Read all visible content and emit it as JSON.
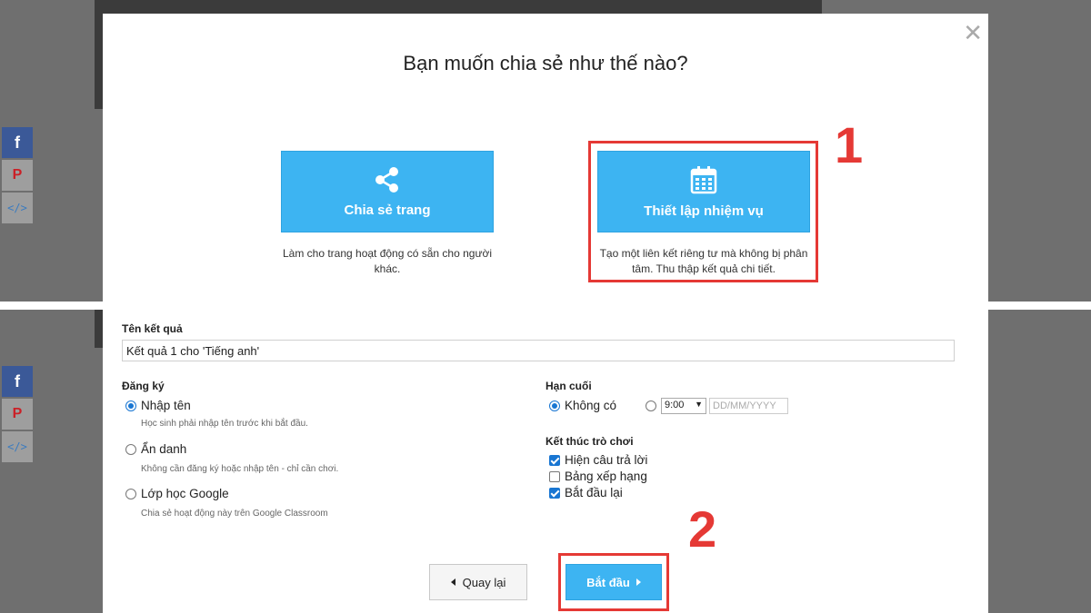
{
  "dialog": {
    "title": "Bạn muốn chia sẻ như thế nào?",
    "close_glyph": "✕"
  },
  "share_options": [
    {
      "label": "Chia sẻ trang",
      "icon": "share-icon",
      "description": "Làm cho trang hoạt động có sẵn cho người khác."
    },
    {
      "label": "Thiết lập nhiệm vụ",
      "icon": "calendar-icon",
      "description": "Tạo một liên kết riêng tư mà không bị phân tâm. Thu thập kết quả chi tiết."
    }
  ],
  "annotations": {
    "step1": "1",
    "step2": "2",
    "color": "#e53935"
  },
  "form": {
    "result_name_label": "Tên kết quả",
    "result_name_value": "Kết quả 1 cho 'Tiếng anh'",
    "registration_label": "Đăng ký",
    "registration_options": [
      {
        "label": "Nhập tên",
        "hint": "Học sinh phải nhập tên trước khi bắt đầu.",
        "selected": true
      },
      {
        "label": "Ẩn danh",
        "hint": "Không cần đăng ký hoặc nhập tên - chỉ cần chơi.",
        "selected": false
      },
      {
        "label": "Lớp học Google",
        "hint": "Chia sẻ hoạt động này trên Google Classroom",
        "selected": false
      }
    ],
    "deadline_label": "Hạn cuối",
    "deadline_none_label": "Không có",
    "deadline_time_value": "9:00",
    "deadline_date_placeholder": "DD/MM/YYYY",
    "end_game_label": "Kết thúc trò chơi",
    "end_game_options": [
      {
        "label": "Hiện câu trả lời",
        "checked": true
      },
      {
        "label": "Bảng xếp hạng",
        "checked": false
      },
      {
        "label": "Bắt đầu lại",
        "checked": true
      }
    ]
  },
  "buttons": {
    "back": "Quay lại",
    "start": "Bắt đầu"
  },
  "colors": {
    "accent": "#3db4f2",
    "check": "#1976d2"
  }
}
